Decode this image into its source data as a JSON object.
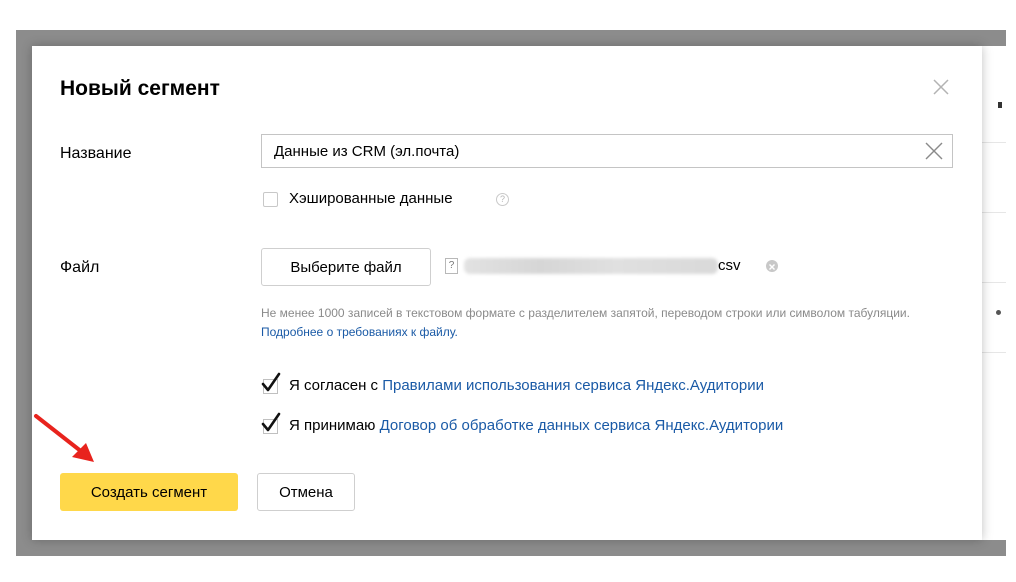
{
  "dialog": {
    "title": "Новый сегмент"
  },
  "name_field": {
    "label": "Название",
    "value": "Данные из CRM (эл.почта)"
  },
  "hashed": {
    "label": "Хэшированные данные",
    "checked": false,
    "help_icon": "question-circle-icon"
  },
  "file_field": {
    "label": "Файл",
    "button_label": "Выберите файл",
    "file_ext": "csv",
    "hint_text": "Не менее 1000 записей в текстовом формате с разделителем запятой, переводом строки или символом табуляции. ",
    "hint_link": "Подробнее о требованиях к файлу."
  },
  "agreements": [
    {
      "prefix": "Я согласен с ",
      "link": "Правилами использования сервиса Яндекс.Аудитории",
      "checked": true
    },
    {
      "prefix": "Я принимаю ",
      "link": "Договор об обработке данных сервиса Яндекс.Аудитории",
      "checked": true
    }
  ],
  "actions": {
    "create_label": "Создать сегмент",
    "cancel_label": "Отмена"
  },
  "colors": {
    "primary_button": "#ffd84a",
    "link": "#1a5aa6",
    "annotation_arrow": "#e8231d",
    "checkmark": "#111111"
  }
}
